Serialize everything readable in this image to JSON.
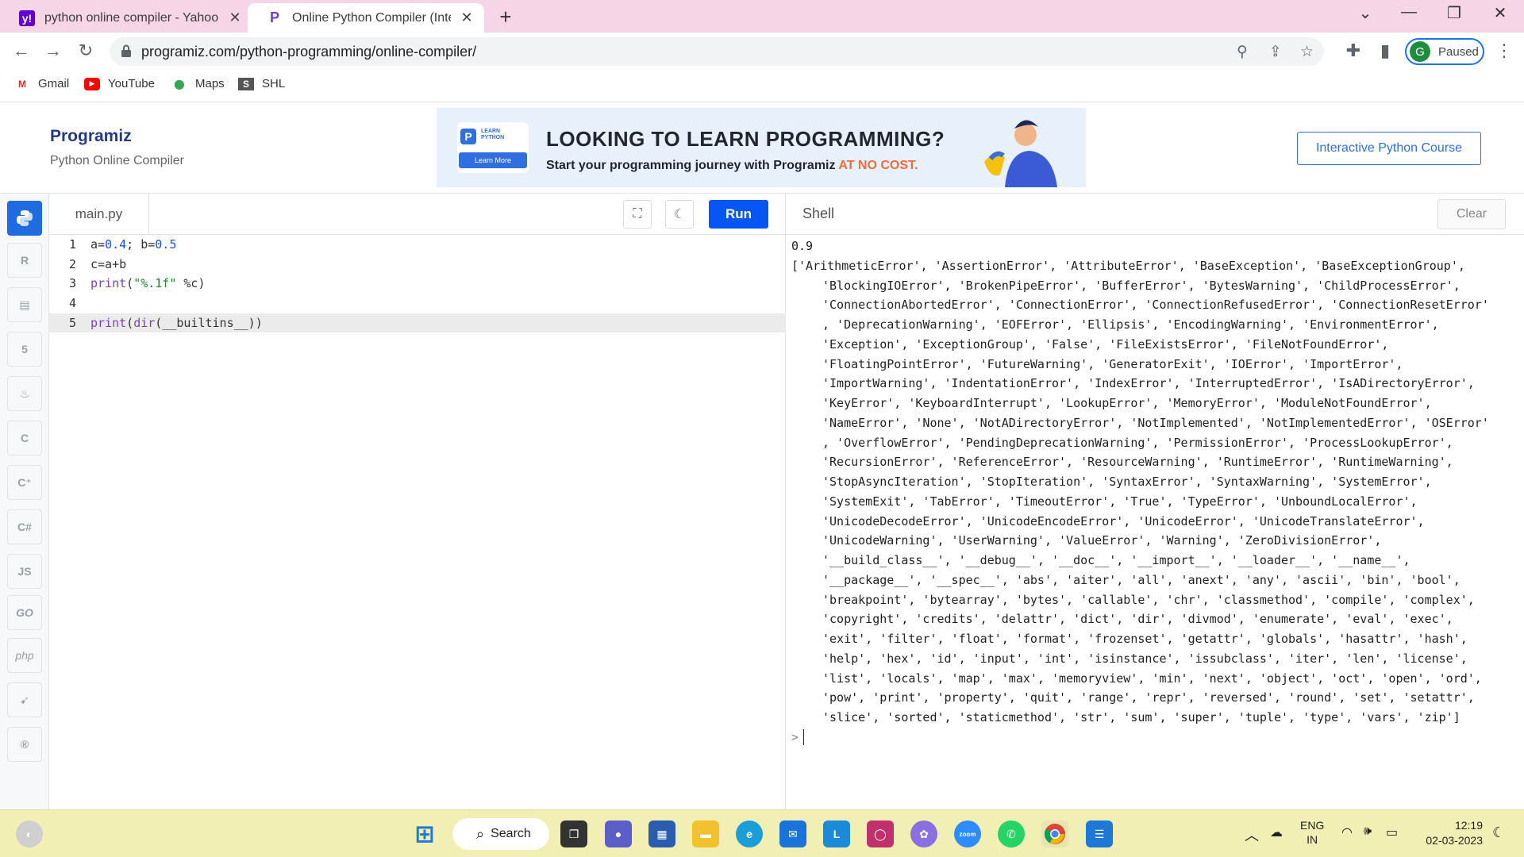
{
  "browser": {
    "tabs": [
      {
        "title": "python online compiler - Yahoo S",
        "favicon": "y!"
      },
      {
        "title": "Online Python Compiler (Interpre",
        "favicon": "P"
      }
    ],
    "url": "programiz.com/python-programming/online-compiler/",
    "profile_letter": "G",
    "profile_status": "Paused",
    "bookmarks": [
      "Gmail",
      "YouTube",
      "Maps",
      "SHL"
    ]
  },
  "site": {
    "logo": "Programiz",
    "subtitle": "Python Online Compiler",
    "banner": {
      "badge_title": "LEARN PYTHON",
      "badge_button": "Learn More",
      "headline": "LOOKING TO LEARN PROGRAMMING?",
      "subline": "Start your programming journey with Programiz ",
      "subline_highlight": "AT NO COST."
    },
    "course_button": "Interactive Python Course"
  },
  "sidebar": {
    "languages": [
      "python",
      "r",
      "sql",
      "html",
      "java",
      "c",
      "c++",
      "c#",
      "JS",
      "GO",
      "php",
      "swift",
      "rust"
    ]
  },
  "editor": {
    "file_tab": "main.py",
    "run_label": "Run",
    "current_line": 5,
    "lines": [
      "a=0.4; b=0.5",
      "c=a+b",
      "print(\"%.1f\" %c)",
      "",
      "print(dir(__builtins__))"
    ]
  },
  "shell": {
    "title": "Shell",
    "clear_label": "Clear",
    "output_lines": [
      "0.9",
      "['ArithmeticError', 'AssertionError', 'AttributeError', 'BaseException', 'BaseExceptionGroup',",
      "'BlockingIOError', 'BrokenPipeError', 'BufferError', 'BytesWarning', 'ChildProcessError',",
      "'ConnectionAbortedError', 'ConnectionError', 'ConnectionRefusedError', 'ConnectionResetError'",
      ", 'DeprecationWarning', 'EOFError', 'Ellipsis', 'EncodingWarning', 'EnvironmentError',",
      "'Exception', 'ExceptionGroup', 'False', 'FileExistsError', 'FileNotFoundError',",
      "'FloatingPointError', 'FutureWarning', 'GeneratorExit', 'IOError', 'ImportError',",
      "'ImportWarning', 'IndentationError', 'IndexError', 'InterruptedError', 'IsADirectoryError',",
      "'KeyError', 'KeyboardInterrupt', 'LookupError', 'MemoryError', 'ModuleNotFoundError',",
      "'NameError', 'None', 'NotADirectoryError', 'NotImplemented', 'NotImplementedError', 'OSError'",
      ", 'OverflowError', 'PendingDeprecationWarning', 'PermissionError', 'ProcessLookupError',",
      "'RecursionError', 'ReferenceError', 'ResourceWarning', 'RuntimeError', 'RuntimeWarning',",
      "'StopAsyncIteration', 'StopIteration', 'SyntaxError', 'SyntaxWarning', 'SystemError',",
      "'SystemExit', 'TabError', 'TimeoutError', 'True', 'TypeError', 'UnboundLocalError',",
      "'UnicodeDecodeError', 'UnicodeEncodeError', 'UnicodeError', 'UnicodeTranslateError',",
      "'UnicodeWarning', 'UserWarning', 'ValueError', 'Warning', 'ZeroDivisionError',",
      "'__build_class__', '__debug__', '__doc__', '__import__', '__loader__', '__name__',",
      "'__package__', '__spec__', 'abs', 'aiter', 'all', 'anext', 'any', 'ascii', 'bin', 'bool',",
      "'breakpoint', 'bytearray', 'bytes', 'callable', 'chr', 'classmethod', 'compile', 'complex',",
      "'copyright', 'credits', 'delattr', 'dict', 'dir', 'divmod', 'enumerate', 'eval', 'exec',",
      "'exit', 'filter', 'float', 'format', 'frozenset', 'getattr', 'globals', 'hasattr', 'hash',",
      "'help', 'hex', 'id', 'input', 'int', 'isinstance', 'issubclass', 'iter', 'len', 'license',",
      "'list', 'locals', 'map', 'max', 'memoryview', 'min', 'next', 'object', 'oct', 'open', 'ord',",
      "'pow', 'print', 'property', 'quit', 'range', 'repr', 'reversed', 'round', 'set', 'setattr',",
      "'slice', 'sorted', 'staticmethod', 'str', 'sum', 'super', 'tuple', 'type', 'vars', 'zip']"
    ],
    "prompt": ">"
  },
  "taskbar": {
    "search_label": "Search",
    "language_line1": "ENG",
    "language_line2": "IN",
    "time": "12:19",
    "date": "02-03-2023"
  }
}
